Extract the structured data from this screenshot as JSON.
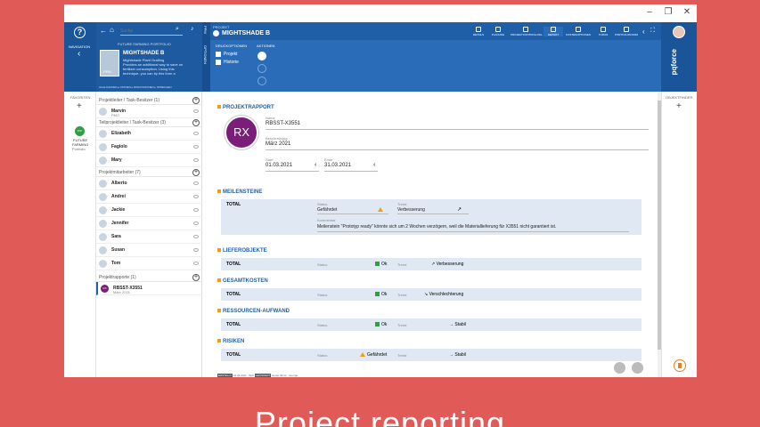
{
  "window": {
    "minimize": "–",
    "maximize": "❐",
    "close": "✕"
  },
  "nav": {
    "help": "?",
    "label": "NAVIGATION",
    "back": "‹"
  },
  "left_header": {
    "search_placeholder": "Suche",
    "portfolio": "FUTURE FARMING PORTFOLIO",
    "project_name": "MIGHTSHADE B",
    "desc1": "Mightshade Plant Grafting",
    "desc2": "Provides an additional way to save on",
    "desc3": "fertilizer consumption. Using this",
    "desc4": "technique, you can by this form a",
    "tags": "ALLE KAUFEN ▸ OFFNEN ▸ DISKUSSIONEN ▸ SPRECHEN",
    "badge": "PPM"
  },
  "vstrip": {
    "top": "PPM",
    "mid": "OPTIONEN"
  },
  "project": {
    "label": "PROJEKT",
    "name": "MIGHTSHADE B"
  },
  "topnav": [
    {
      "label": "DETAILS"
    },
    {
      "label": "PLANUNG"
    },
    {
      "label": "PROJEKTCONTROLLING"
    },
    {
      "label": "REPORT"
    },
    {
      "label": "KOSTENOPTIONEN"
    },
    {
      "label": "TODOS"
    },
    {
      "label": "PORTFOLIOFORM"
    }
  ],
  "druck": {
    "title": "DRUCKOPTIONEN",
    "opt1": "Projekt",
    "opt2": "Historie",
    "aktionen": "AKTIONEN"
  },
  "brand": "pqforce",
  "fav": {
    "label": "FAVORITEN",
    "plus": "+",
    "logo_text": "FFP",
    "name1": "FUTURE",
    "name2": "FARMING",
    "name3": "Portfolio"
  },
  "objects": {
    "label": "OBJEKTFINDER",
    "plus": "+"
  },
  "groups": {
    "g1": "Projektleiter / Task-Besitzer (1)",
    "g2": "Teilprojektleiter / Task-Besitzer (3)",
    "g3": "Projektmitarbeiter (7)",
    "g4": "Projektrapporte (1)"
  },
  "people": {
    "p1": {
      "name": "Marvin",
      "sub": "PMO"
    },
    "p2": {
      "name": "Elizabeth"
    },
    "p3": {
      "name": "Fagiolo"
    },
    "p4": {
      "name": "Mary"
    },
    "p5": {
      "name": "Alberto"
    },
    "p6": {
      "name": "Andrei"
    },
    "p7": {
      "name": "Jackie"
    },
    "p8": {
      "name": "Jennifer"
    },
    "p9": {
      "name": "Sara"
    },
    "p10": {
      "name": "Susan"
    },
    "p11": {
      "name": "Tom"
    },
    "r1": {
      "name": "RBSST-X3551",
      "sub": "März 2021",
      "badge": "RX"
    }
  },
  "report": {
    "title": "PROJEKTRAPPORT",
    "badge": "RX",
    "name_label": "Name",
    "name_value": "RBSST-X3551",
    "desc_label": "Beschreibung",
    "desc_value": "März 2021",
    "start_label": "Start",
    "start_value": "01.03.2021",
    "end_label": "Ende",
    "end_value": "31.03.2021"
  },
  "sections": {
    "meilen": "MEILENSTEINE",
    "liefer": "LIEFEROBJEKTE",
    "gesamt": "GESAMTKOSTEN",
    "ress": "RESSOURCEN-AUFWAND",
    "risk": "RISIKEN"
  },
  "total": "TOTAL",
  "status_label": "Status",
  "trend_label": "Trend",
  "comment_label": "Kommentar",
  "meilen": {
    "status": "Gefährdet",
    "trend": "Verbesserung",
    "comment": "Meilenstein \"Prototyp ready\" könnte sich um 2 Wochen verzögern, weil die Materiallieferung für X3551 nicht garantiert ist."
  },
  "rows": {
    "liefer": {
      "status": "Ok",
      "trend": "Verbesserung"
    },
    "gesamt": {
      "status": "Ok",
      "trend": "Verschlechterung"
    },
    "ress": {
      "status": "Ok",
      "trend": "Stabil"
    },
    "risk": {
      "status": "Gefährdet",
      "trend": "Stabil"
    }
  },
  "footer": {
    "erstellt": "ERSTELLT",
    "d1": "04.03.2021 · Bob",
    "geandert": "GEÄNDERT",
    "d2": "Heute 09:34 · George"
  },
  "caption": "Project reporting"
}
